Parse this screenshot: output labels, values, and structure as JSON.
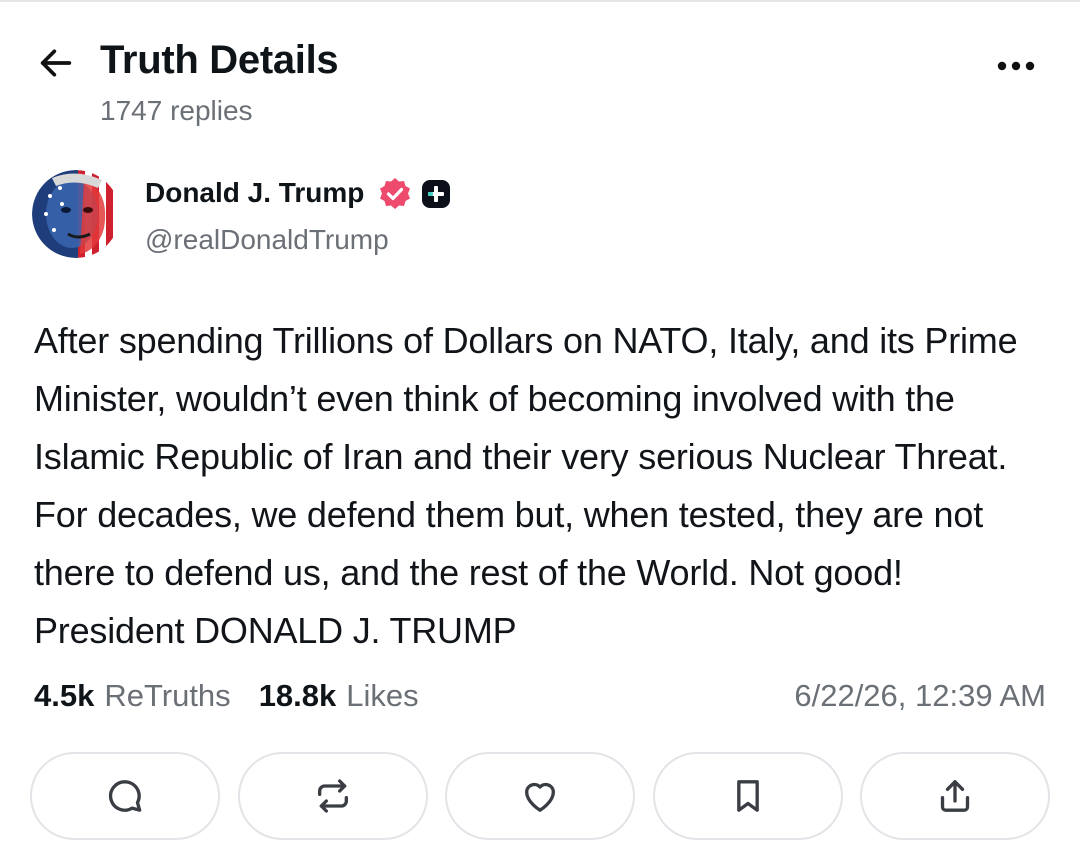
{
  "header": {
    "title": "Truth Details",
    "reply_count": "1747 replies",
    "back_icon": "arrow-left-icon",
    "more_icon": "more-horizontal-icon"
  },
  "post": {
    "author_name": "Donald J. Trump",
    "author_handle": "@realDonaldTrump",
    "verified_color": "#ee4a6e",
    "text": "After spending Trillions of Dollars on NATO, Italy, and its Prime Minister, wouldn’t even think of becoming involved with the Islamic Republic of Iran and their very serious Nuclear Threat. For decades, we defend them but, when tested, they are not there to defend us, and the rest of the World. Not good! President DONALD J. TRUMP",
    "retruths_count": "4.5k",
    "retruths_label": "ReTruths",
    "likes_count": "18.8k",
    "likes_label": "Likes",
    "timestamp": "6/22/26, 12:39 AM"
  },
  "actions": [
    {
      "name": "reply",
      "icon": "reply-bubble-icon"
    },
    {
      "name": "retruth",
      "icon": "retruth-icon"
    },
    {
      "name": "like",
      "icon": "heart-icon"
    },
    {
      "name": "bookmark",
      "icon": "bookmark-icon"
    },
    {
      "name": "share",
      "icon": "share-icon"
    }
  ]
}
